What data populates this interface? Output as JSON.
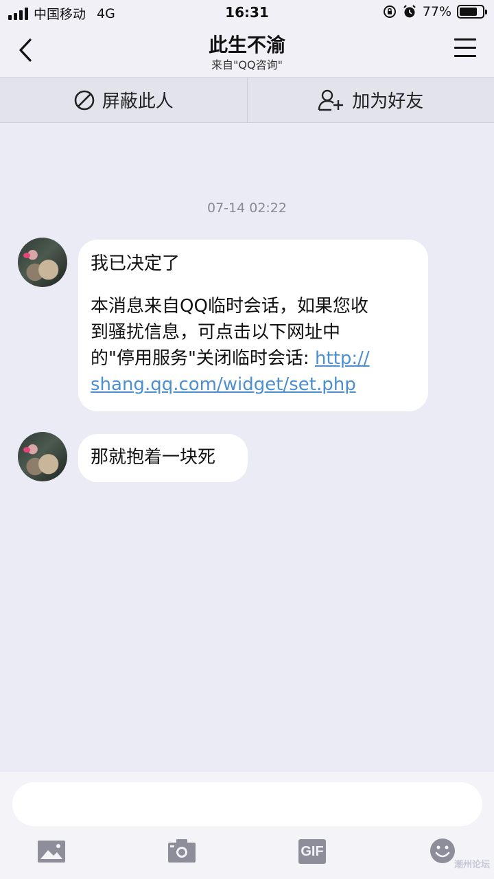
{
  "status_bar": {
    "carrier": "中国移动",
    "network": "4G",
    "time": "16:31",
    "battery": "77%",
    "battery_level": 0.77
  },
  "header": {
    "title": "此生不渝",
    "subtitle": "来自\"QQ咨询\""
  },
  "action_bar": {
    "block_label": "屏蔽此人",
    "add_friend_label": "加为好友"
  },
  "chat": {
    "timestamp": "07-14 02:22",
    "messages": [
      {
        "line1": "我已决定了",
        "line2": "本消息来自QQ临时会话，如果您收",
        "line3": "到骚扰信息，可点击以下网址中",
        "line4": "的\"停用服务\"关闭临时会话: ",
        "link_part1": "http://",
        "link_part2": "shang.qq.com/widget/set.php"
      },
      {
        "text": "那就抱着一块死"
      }
    ]
  },
  "toolbar": {
    "gif_label": "GIF"
  },
  "watermark": "潮州论坛",
  "colors": {
    "background": "#ebebf5",
    "bubble": "#ffffff",
    "link": "#4c8fd0",
    "icon_gray": "#8e8e9a"
  }
}
